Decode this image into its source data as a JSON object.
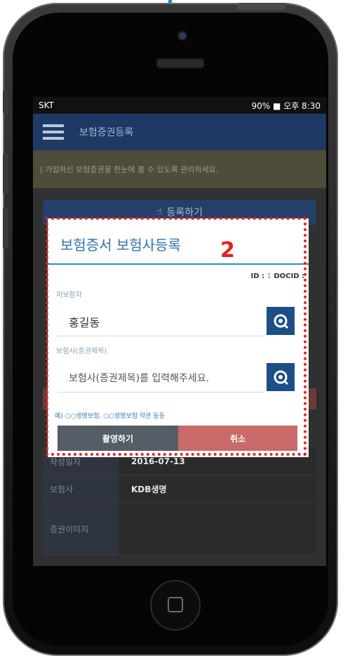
{
  "status_bar": {
    "carrier": "SKT",
    "right": "90% ■ 오후 8:30"
  },
  "app_bar": {
    "title": "보험증권등록"
  },
  "notice": {
    "text": "| 가입하신 보험증권을 한눈에 볼 수 있도록 관리하세요."
  },
  "background": {
    "register_label": "등록하기",
    "table": [
      {
        "label": "작성일자",
        "value": "2016-07-13"
      },
      {
        "label": "보험사",
        "value": "KDB생명"
      },
      {
        "label": "증권이미지",
        "value": ""
      }
    ]
  },
  "dialog": {
    "title": "보험증서 보험사등록",
    "annotation_number": "2",
    "id_label": "ID :",
    "id_value": "1",
    "docid_label": "DOCID :",
    "insured_label": "피보험자",
    "insured_value": "홍길동",
    "insurer_label": "보험사(증권제목)",
    "insurer_placeholder": "보험사(증권제목)를 입력해주세요.",
    "hint": "예) ○○생명보험, ○○생명보험 약관 등등",
    "shoot_button": "촬영하기",
    "cancel_button": "취소"
  },
  "colors": {
    "app_bar": "#1e3a64",
    "dialog_title": "#2f72ad",
    "search_button": "#1d4f86",
    "cancel_button": "#c96a6a",
    "shoot_button": "#555d66",
    "annotation": "#e51f1f"
  },
  "icons": {
    "menu": "hamburger-icon",
    "search": "search-icon",
    "register": "hand-pointer-icon"
  }
}
